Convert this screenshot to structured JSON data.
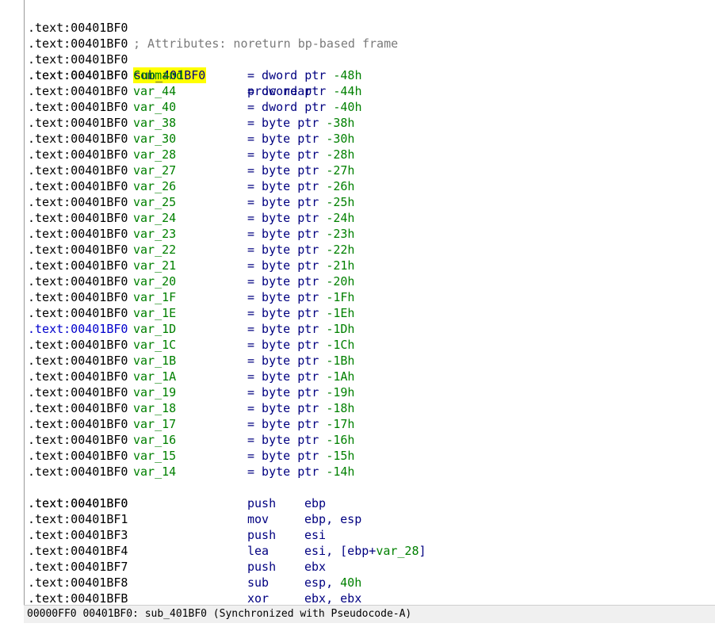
{
  "listing": {
    "header": {
      "addr": ".text:00401BF0",
      "comment": "; Attributes: noreturn bp-based frame"
    },
    "proc": {
      "addr": ".text:00401BF0",
      "name": "sub_401BF0",
      "keyword": "proc near"
    },
    "blank_addr": ".text:00401BF0",
    "vars": [
      {
        "name": "Command",
        "def": "= dword ptr ",
        "off": "-48h"
      },
      {
        "name": "var_44",
        "def": "= dword ptr ",
        "off": "-44h"
      },
      {
        "name": "var_40",
        "def": "= dword ptr ",
        "off": "-40h"
      },
      {
        "name": "var_38",
        "def": "= byte ptr ",
        "off": "-38h"
      },
      {
        "name": "var_30",
        "def": "= byte ptr ",
        "off": "-30h"
      },
      {
        "name": "var_28",
        "def": "= byte ptr ",
        "off": "-28h"
      },
      {
        "name": "var_27",
        "def": "= byte ptr ",
        "off": "-27h"
      },
      {
        "name": "var_26",
        "def": "= byte ptr ",
        "off": "-26h"
      },
      {
        "name": "var_25",
        "def": "= byte ptr ",
        "off": "-25h"
      },
      {
        "name": "var_24",
        "def": "= byte ptr ",
        "off": "-24h"
      },
      {
        "name": "var_23",
        "def": "= byte ptr ",
        "off": "-23h"
      },
      {
        "name": "var_22",
        "def": "= byte ptr ",
        "off": "-22h"
      },
      {
        "name": "var_21",
        "def": "= byte ptr ",
        "off": "-21h"
      },
      {
        "name": "var_20",
        "def": "= byte ptr ",
        "off": "-20h"
      },
      {
        "name": "var_1F",
        "def": "= byte ptr ",
        "off": "-1Fh"
      },
      {
        "name": "var_1E",
        "def": "= byte ptr ",
        "off": "-1Eh"
      },
      {
        "name": "var_1D",
        "def": "= byte ptr ",
        "off": "-1Dh",
        "current": true
      },
      {
        "name": "var_1C",
        "def": "= byte ptr ",
        "off": "-1Ch"
      },
      {
        "name": "var_1B",
        "def": "= byte ptr ",
        "off": "-1Bh"
      },
      {
        "name": "var_1A",
        "def": "= byte ptr ",
        "off": "-1Ah"
      },
      {
        "name": "var_19",
        "def": "= byte ptr ",
        "off": "-19h"
      },
      {
        "name": "var_18",
        "def": "= byte ptr ",
        "off": "-18h"
      },
      {
        "name": "var_17",
        "def": "= byte ptr ",
        "off": "-17h"
      },
      {
        "name": "var_16",
        "def": "= byte ptr ",
        "off": "-16h"
      },
      {
        "name": "var_15",
        "def": "= byte ptr ",
        "off": "-15h"
      },
      {
        "name": "var_14",
        "def": "= byte ptr ",
        "off": "-14h"
      }
    ],
    "instructions": [
      {
        "addr": ".text:00401BF0",
        "mnem": "push",
        "ops": [
          {
            "t": "ebp"
          }
        ]
      },
      {
        "addr": ".text:00401BF1",
        "mnem": "mov",
        "ops": [
          {
            "t": "ebp, esp"
          }
        ]
      },
      {
        "addr": ".text:00401BF3",
        "mnem": "push",
        "ops": [
          {
            "t": "esi"
          }
        ]
      },
      {
        "addr": ".text:00401BF4",
        "mnem": "lea",
        "ops": [
          {
            "t": "esi, [ebp+"
          },
          {
            "t": "var_28",
            "k": "var"
          },
          {
            "t": "]"
          }
        ]
      },
      {
        "addr": ".text:00401BF7",
        "mnem": "push",
        "ops": [
          {
            "t": "ebx"
          }
        ]
      },
      {
        "addr": ".text:00401BF8",
        "mnem": "sub",
        "ops": [
          {
            "t": "esp, "
          },
          {
            "t": "40h",
            "k": "num"
          }
        ]
      },
      {
        "addr": ".text:00401BFB",
        "mnem": "xor",
        "ops": [
          {
            "t": "ebx, ebx"
          }
        ]
      }
    ]
  },
  "status": {
    "text": "00000FF0 00401BF0: sub_401BF0 (Synchronized with Pseudocode-A)"
  },
  "colors": {
    "address": "#000000",
    "current_address": "#0000cc",
    "name": "#008000",
    "keyword": "#000080",
    "comment": "#7a7a7a",
    "highlight": "#ffff00",
    "breakpoint_dot": "#5aa8e0"
  }
}
